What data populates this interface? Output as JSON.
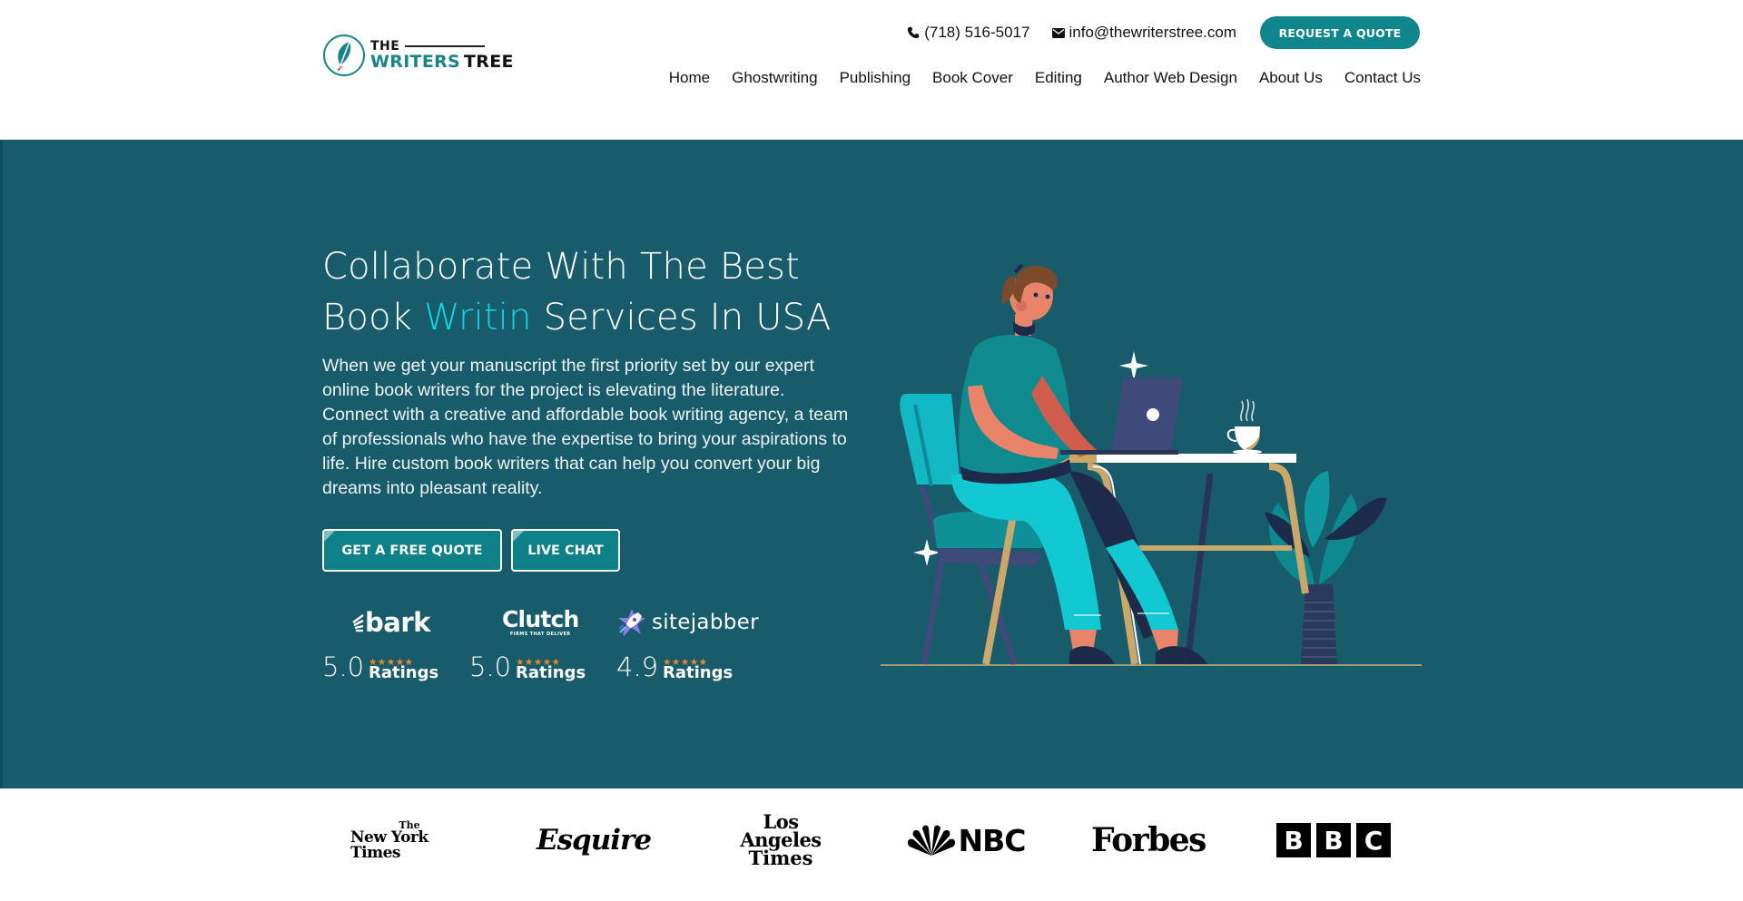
{
  "header": {
    "logo": {
      "line1": "THE",
      "line2_accent": "WRITERS",
      "line2_rest": "TREE"
    },
    "phone": "(718) 516-5017",
    "email": "info@thewriterstree.com",
    "quote_button": "REQUEST A QUOTE",
    "nav": [
      {
        "label": "Home"
      },
      {
        "label": "Ghostwriting"
      },
      {
        "label": "Publishing"
      },
      {
        "label": "Book Cover"
      },
      {
        "label": "Editing"
      },
      {
        "label": "Author Web Design"
      },
      {
        "label": "About Us"
      },
      {
        "label": "Contact Us"
      }
    ]
  },
  "hero": {
    "headline_line1": "Collaborate With The Best",
    "headline_pre": "Book ",
    "headline_accent": "Writin",
    "headline_post": " Services In USA",
    "description": "When we get your manuscript the first priority set by our expert online book writers for the project is elevating the literature. Connect with a creative and affordable book writing agency, a team of professionals who have the expertise to bring your aspirations to life. Hire custom book writers that can help you convert your big dreams into pleasant reality.",
    "cta_primary": "GET A FREE QUOTE",
    "cta_secondary": "LIVE CHAT",
    "ratings": [
      {
        "brand": "bark",
        "score": "5.0",
        "stars": "★★★★★",
        "label": "Ratings"
      },
      {
        "brand": "Clutch",
        "tagline": "FIRMS THAT DELIVER",
        "score": "5.0",
        "stars": "★★★★★",
        "label": "Ratings"
      },
      {
        "brand": "sitejabber",
        "score": "4.9",
        "stars": "★★★★★",
        "label": "Ratings"
      }
    ]
  },
  "press": {
    "logos": [
      {
        "the": "The",
        "name": "New York Times"
      },
      {
        "name": "Esquire"
      },
      {
        "line1": "Los Angeles",
        "line2": "Times"
      },
      {
        "name": "NBC"
      },
      {
        "name": "Forbes"
      },
      {
        "letters": [
          "B",
          "B",
          "C"
        ]
      }
    ]
  },
  "colors": {
    "brand_teal": "#0f858c",
    "hero_bg": "#185b6b",
    "headline_accent": "#12d3e8",
    "star": "#f38a22"
  }
}
